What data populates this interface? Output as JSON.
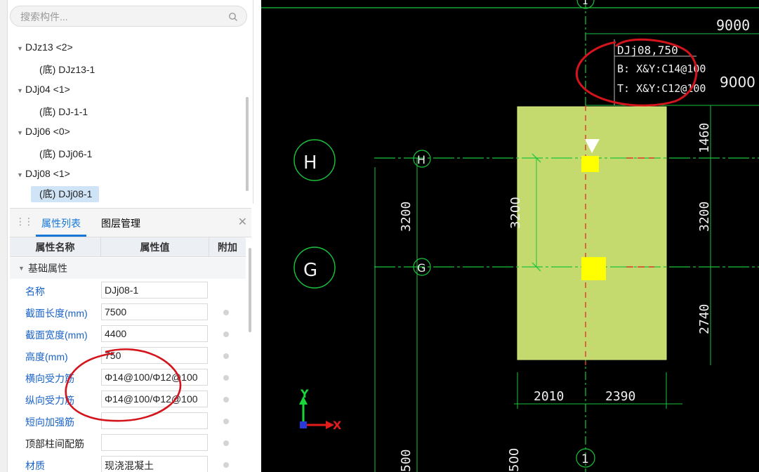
{
  "search": {
    "placeholder": "搜索构件..."
  },
  "tree": [
    {
      "label": "DJz13 <2>",
      "level": 0
    },
    {
      "label": "(底) DJz13-1",
      "level": 1
    },
    {
      "label": "DJj04 <1>",
      "level": 0
    },
    {
      "label": "(底) DJ-1-1",
      "level": 1
    },
    {
      "label": "DJj06 <0>",
      "level": 0
    },
    {
      "label": "(底) DJj06-1",
      "level": 1
    },
    {
      "label": "DJj08 <1>",
      "level": 0
    },
    {
      "label": "(底) DJj08-1",
      "level": 1,
      "selected": true
    }
  ],
  "props_panel": {
    "tabs": [
      "属性列表",
      "图层管理"
    ],
    "active_tab": "属性列表",
    "columns": [
      "属性名称",
      "属性值",
      "附加"
    ],
    "group": "基础属性",
    "rows": [
      {
        "name": "名称",
        "value": "DJj08-1",
        "has_attach": false
      },
      {
        "name": "截面长度(mm)",
        "value": "7500",
        "has_attach": true
      },
      {
        "name": "截面宽度(mm)",
        "value": "4400",
        "has_attach": true
      },
      {
        "name": "高度(mm)",
        "value": "750",
        "has_attach": true
      },
      {
        "name": "横向受力筋",
        "value": "Φ14@100/Φ12@100",
        "has_attach": true
      },
      {
        "name": "纵向受力筋",
        "value": "Φ14@100/Φ12@100",
        "has_attach": true
      },
      {
        "name": "短向加强筋",
        "value": "",
        "has_attach": true
      },
      {
        "name": "顶部柱间配筋",
        "value": "",
        "has_attach": true,
        "black": true
      },
      {
        "name": "材质",
        "value": "现浇混凝土",
        "has_attach": true
      }
    ]
  },
  "cad": {
    "axis_top": "1",
    "axis_bottom": "1",
    "axis_h": "H",
    "axis_g": "G",
    "dim_top": "9000",
    "dim_right_top": "9000",
    "dim_3200_left": "3200",
    "dim_3200_mid": "3200",
    "dim_1460": "1460",
    "dim_3200_right": "3200",
    "dim_2740": "2740",
    "dim_2010": "2010",
    "dim_2390": "2390",
    "dim_500": "500",
    "dim_500b": "500",
    "label_line1": "DJj08,750",
    "label_line2": "B: X&Y:C14@100",
    "label_line3": "T: X&Y:C12@100",
    "ucs_y": "Y",
    "ucs_x": "X",
    "colors": {
      "footing": "#c4da6e",
      "column": "#ffff00",
      "grid": "#19c43a",
      "annotation_circle": "#d4141c"
    }
  }
}
